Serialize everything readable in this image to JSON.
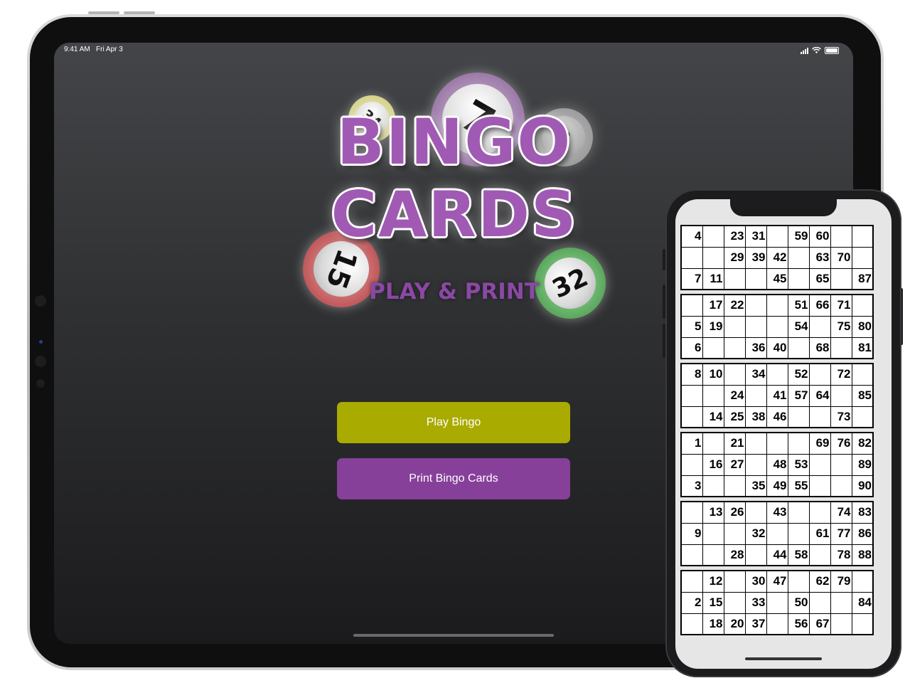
{
  "status_bar": {
    "time": "9:41 AM",
    "date": "Fri Apr 3"
  },
  "logo": {
    "line1": "BINGO",
    "line2": "CARDS",
    "tagline": "PLAY & PRINT",
    "balls": [
      {
        "number": "7",
        "ring_color": "#9c7aa8"
      },
      {
        "number": "34",
        "ring_color": "#d3d08a"
      },
      {
        "number": "8",
        "ring_color": "#bdbdbd"
      },
      {
        "number": "15",
        "ring_color": "#c0585a"
      },
      {
        "number": "32",
        "ring_color": "#5aa85c"
      }
    ]
  },
  "buttons": {
    "play": "Play Bingo",
    "print": "Print Bingo Cards"
  },
  "colors": {
    "play_button": "#a9ab00",
    "print_button": "#86409a",
    "logo_purple": "#a05ab4"
  },
  "bingo_cards": [
    [
      [
        "4",
        "",
        "23",
        "31",
        "",
        "59",
        "60",
        "",
        ""
      ],
      [
        "",
        "",
        "29",
        "39",
        "42",
        "",
        "63",
        "70",
        ""
      ],
      [
        "7",
        "11",
        "",
        "",
        "45",
        "",
        "65",
        "",
        "87"
      ]
    ],
    [
      [
        "",
        "17",
        "22",
        "",
        "",
        "51",
        "66",
        "71",
        ""
      ],
      [
        "5",
        "19",
        "",
        "",
        "",
        "54",
        "",
        "75",
        "80"
      ],
      [
        "6",
        "",
        "",
        "36",
        "40",
        "",
        "68",
        "",
        "81"
      ]
    ],
    [
      [
        "8",
        "10",
        "",
        "34",
        "",
        "52",
        "",
        "72",
        ""
      ],
      [
        "",
        "",
        "24",
        "",
        "41",
        "57",
        "64",
        "",
        "85"
      ],
      [
        "",
        "14",
        "25",
        "38",
        "46",
        "",
        "",
        "73",
        ""
      ]
    ],
    [
      [
        "1",
        "",
        "21",
        "",
        "",
        "",
        "69",
        "76",
        "82"
      ],
      [
        "",
        "16",
        "27",
        "",
        "48",
        "53",
        "",
        "",
        "89"
      ],
      [
        "3",
        "",
        "",
        "35",
        "49",
        "55",
        "",
        "",
        "90"
      ]
    ],
    [
      [
        "",
        "13",
        "26",
        "",
        "43",
        "",
        "",
        "74",
        "83"
      ],
      [
        "9",
        "",
        "",
        "32",
        "",
        "",
        "61",
        "77",
        "86"
      ],
      [
        "",
        "",
        "28",
        "",
        "44",
        "58",
        "",
        "78",
        "88"
      ]
    ],
    [
      [
        "",
        "12",
        "",
        "30",
        "47",
        "",
        "62",
        "79",
        ""
      ],
      [
        "2",
        "15",
        "",
        "33",
        "",
        "50",
        "",
        "",
        "84"
      ],
      [
        "",
        "18",
        "20",
        "37",
        "",
        "56",
        "67",
        "",
        ""
      ]
    ]
  ]
}
